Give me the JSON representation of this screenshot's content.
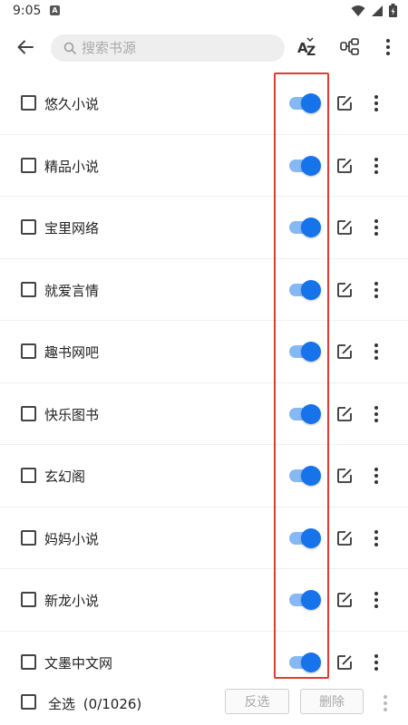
{
  "status_bar": {
    "time": "9:05",
    "notification_icon": "A"
  },
  "toolbar": {
    "search_placeholder": "搜索书源",
    "sort_icon": "az-sort-icon",
    "group_icon": "group-icon",
    "more_icon": "more-vert-icon"
  },
  "sources": [
    {
      "name": "悠久小说",
      "enabled": true,
      "checked": false
    },
    {
      "name": "精品小说",
      "enabled": true,
      "checked": false
    },
    {
      "name": "宝里网络",
      "enabled": true,
      "checked": false
    },
    {
      "name": "就爱言情",
      "enabled": true,
      "checked": false
    },
    {
      "name": "趣书网吧",
      "enabled": true,
      "checked": false
    },
    {
      "name": "快乐图书",
      "enabled": true,
      "checked": false
    },
    {
      "name": "玄幻阁",
      "enabled": true,
      "checked": false
    },
    {
      "name": "妈妈小说",
      "enabled": true,
      "checked": false
    },
    {
      "name": "新龙小说",
      "enabled": true,
      "checked": false
    },
    {
      "name": "文墨中文网",
      "enabled": true,
      "checked": false
    }
  ],
  "bottom_bar": {
    "select_all_label": "全选",
    "select_count": "(0/1026)",
    "invert_label": "反选",
    "delete_label": "删除"
  },
  "colors": {
    "accent": "#1773ea",
    "switch_track": "#86b8f4",
    "highlight": "#e53935"
  }
}
